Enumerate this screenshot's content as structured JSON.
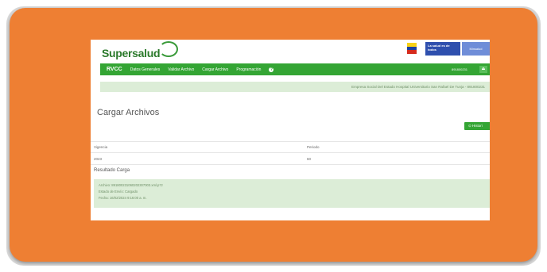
{
  "colors": {
    "frame": "#ee7f33",
    "nav_green": "#34a534",
    "light_green": "#dcedd7",
    "gov_blue": "#2e4fae"
  },
  "header": {
    "logo_text": "Supersalud",
    "gov_badge": "La salud es de todos",
    "gov_link": "Minsalud"
  },
  "nav": {
    "brand": "RVCC",
    "items": [
      "Datos Generales",
      "Validar Archivo",
      "Cargar Archivo",
      "Programación"
    ],
    "user": "891800231"
  },
  "entity_text": "Empresa Social Del Estado Hospital Universitario San Rafael De Tunja - 891800231",
  "page_title": "Cargar Archivos",
  "history_button": "Histori",
  "form": {
    "vigencia_label": "Vigencia",
    "vigencia_value": "2023",
    "periodo_label": "Periodo",
    "periodo_value": "60"
  },
  "result": {
    "title": "Resultado Carga",
    "lines": [
      "Archivo: 891800231060202307003.xml.p7z",
      "Estado de Envío: Cargado",
      "Fecha: 16/02/2024 9:16:00 a. m."
    ]
  }
}
